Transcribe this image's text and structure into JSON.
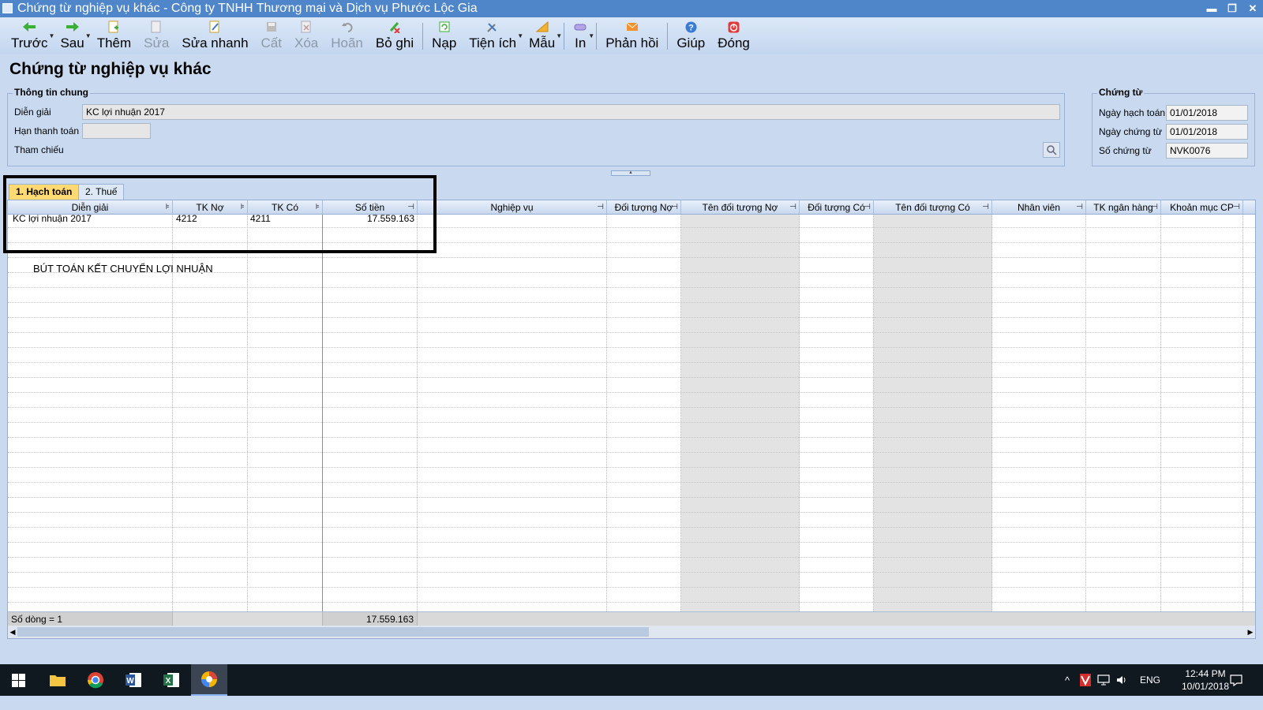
{
  "window": {
    "title": "Chứng từ nghiệp vụ khác - Công ty TNHH Thương mại và Dịch vụ Phước Lộc Gia",
    "minimize": "▬",
    "restore": "❐",
    "close": "✕"
  },
  "toolbar": {
    "prev": "Trước",
    "next": "Sau",
    "add": "Thêm",
    "edit": "Sửa",
    "quick_edit": "Sửa nhanh",
    "save": "Cất",
    "delete": "Xóa",
    "undo": "Hoãn",
    "unpost": "Bỏ ghi",
    "load": "Nạp",
    "utilities": "Tiện ích",
    "template": "Mẫu",
    "print": "In",
    "feedback": "Phản hồi",
    "help": "Giúp",
    "close": "Đóng"
  },
  "page_title": "Chứng từ nghiệp vụ khác",
  "general_info": {
    "title": "Thông tin chung",
    "description_label": "Diễn giải",
    "description_value": "KC lợi nhuận 2017",
    "due_label": "Hạn thanh toán",
    "due_value": "",
    "reference_label": "Tham chiếu"
  },
  "voucher": {
    "title": "Chứng từ",
    "posting_date_label": "Ngày hạch toán",
    "posting_date": "01/01/2018",
    "voucher_date_label": "Ngày chứng từ",
    "voucher_date": "01/01/2018",
    "voucher_no_label": "Số chứng từ",
    "voucher_no": "NVK0076"
  },
  "tabs": {
    "accounting": "1. Hạch toán",
    "tax": "2. Thuế"
  },
  "grid": {
    "columns": {
      "description": "Diễn giải",
      "debit_account": "TK Nợ",
      "credit_account": "TK Có",
      "amount": "Số tiền",
      "operation": "Nghiệp vụ",
      "debit_object": "Đối tượng Nợ",
      "debit_object_name": "Tên đối tượng Nợ",
      "credit_object": "Đối tượng Có",
      "credit_object_name": "Tên đối tượng Có",
      "employee": "Nhân viên",
      "bank_account": "TK ngân hàng",
      "expense_item": "Khoản mục CP"
    },
    "rows": [
      {
        "description": "KC lợi nhuận 2017",
        "debit_account": "4212",
        "credit_account": "4211",
        "amount": "17.559.163"
      }
    ],
    "note": "BÚT TOÁN KẾT CHUYỂN LỢI NHUẬN",
    "footer": {
      "row_count": "Số dòng = 1",
      "total_amount": "17.559.163"
    }
  },
  "taskbar": {
    "language": "ENG",
    "time": "12:44 PM",
    "date": "10/01/2018"
  }
}
